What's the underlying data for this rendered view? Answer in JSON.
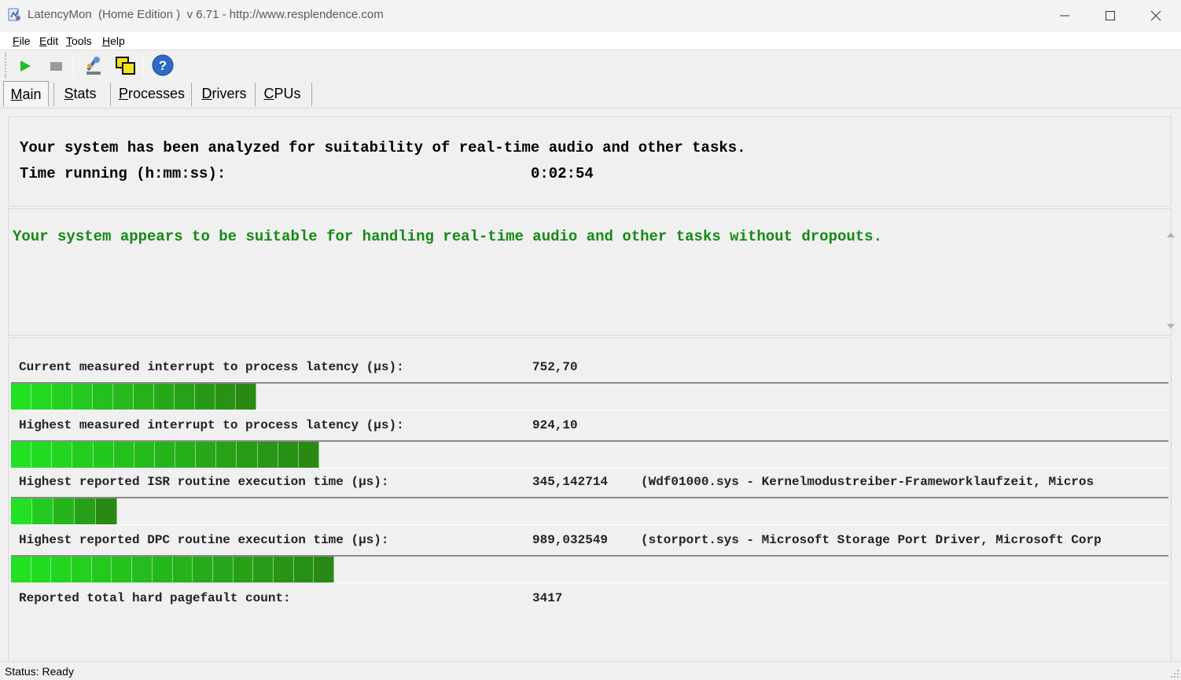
{
  "window": {
    "title": "LatencyMon  (Home Edition )  v 6.71 - http://www.resplendence.com"
  },
  "menu": [
    "File",
    "Edit",
    "Tools",
    "Help"
  ],
  "toolbar": {
    "start_icon": "play-icon",
    "stop_icon": "stop-icon",
    "kernel_icon": "microscope-icon",
    "windows_icon": "windows-icon",
    "help_icon": "help-icon"
  },
  "tabs": [
    {
      "label": "Main",
      "active": true
    },
    {
      "label": "Stats"
    },
    {
      "label": "Processes"
    },
    {
      "label": "Drivers"
    },
    {
      "label": "CPUs"
    }
  ],
  "summary": {
    "line1": "Your system has been analyzed for suitability of real-time audio and other tasks.",
    "time_label": "Time running (h:mm:ss):",
    "time_value": "0:02:54"
  },
  "verdict": {
    "text": "Your system appears to be suitable for handling real-time audio and other tasks without dropouts.",
    "color": "#148a14"
  },
  "metrics": [
    {
      "label": "Current measured interrupt to process latency (µs):",
      "value": "752,70",
      "extra": "",
      "level_fraction": 0.212
    },
    {
      "label": "Highest measured interrupt to process latency (µs):",
      "value": "924,10",
      "extra": "",
      "level_fraction": 0.266
    },
    {
      "label": "Highest reported ISR routine execution time (µs):",
      "value": "345,142714",
      "extra": "(Wdf01000.sys - Kernelmodustreiber-Frameworklaufzeit, Micros",
      "level_fraction": 0.092
    },
    {
      "label": "Highest reported DPC routine execution time (µs):",
      "value": "989,032549",
      "extra": "(storport.sys - Microsoft Storage Port Driver, Microsoft Corp",
      "level_fraction": 0.279
    },
    {
      "label": "Reported total hard pagefault count:",
      "value": "3417",
      "extra": ""
    }
  ],
  "meter_colors": {
    "start": "#22e022",
    "end": "#2a7a12"
  },
  "status": {
    "text": "Status: Ready"
  }
}
